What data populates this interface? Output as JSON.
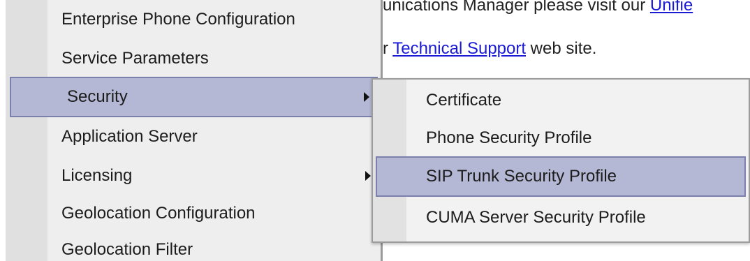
{
  "page": {
    "line1_prefix": "unications Manager please visit our ",
    "line1_link": "Unifie",
    "line2_prefix": "r ",
    "line2_link": "Technical Support",
    "line2_suffix": " web site."
  },
  "main_menu": {
    "items": [
      {
        "label": "Enterprise Phone Configuration",
        "has_submenu": false,
        "selected": false
      },
      {
        "label": "Service Parameters",
        "has_submenu": false,
        "selected": false
      },
      {
        "label": "Security",
        "has_submenu": true,
        "selected": true
      },
      {
        "label": "Application Server",
        "has_submenu": false,
        "selected": false
      },
      {
        "label": "Licensing",
        "has_submenu": true,
        "selected": false
      },
      {
        "label": "Geolocation Configuration",
        "has_submenu": false,
        "selected": false
      },
      {
        "label": "Geolocation Filter",
        "has_submenu": false,
        "selected": false
      }
    ]
  },
  "security_submenu": {
    "items": [
      {
        "label": "Certificate",
        "selected": false
      },
      {
        "label": "Phone Security Profile",
        "selected": false
      },
      {
        "label": "SIP Trunk Security Profile",
        "selected": true
      },
      {
        "label": "CUMA Server Security Profile",
        "selected": false
      }
    ]
  },
  "colors": {
    "highlight_fill": "#b4b8d4",
    "highlight_border": "#7b80ad",
    "menu_background": "#eeeeee",
    "link": "#1a1ad6"
  },
  "icons": {
    "submenu_indicator": "right-triangle-arrow-icon"
  }
}
